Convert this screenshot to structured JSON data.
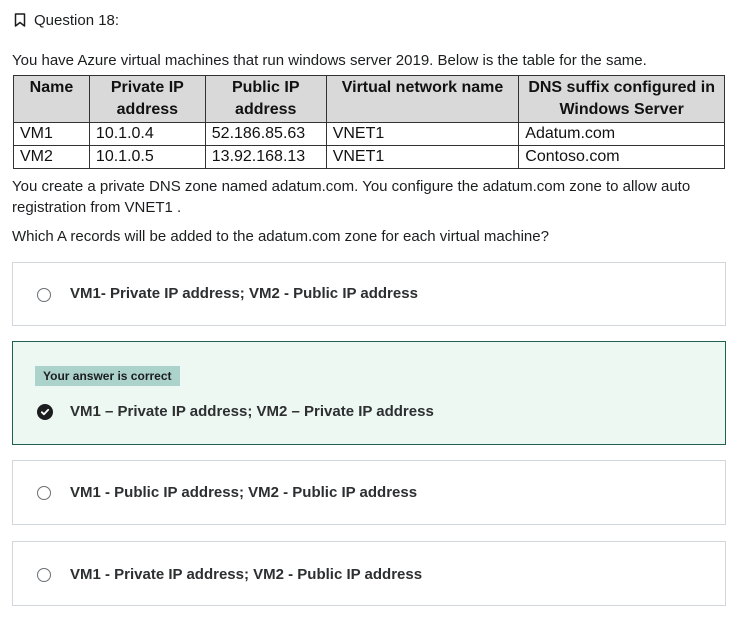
{
  "question": {
    "title": "Question 18:",
    "intro": "You have Azure virtual machines that run windows server 2019. Below is the table for the same.",
    "table": {
      "headers": [
        "Name",
        "Private IP address",
        "Public IP address",
        "Virtual network name",
        "DNS suffix configured in Windows Server"
      ],
      "rows": [
        [
          "VM1",
          "10.1.0.4",
          "52.186.85.63",
          "VNET1",
          "Adatum.com"
        ],
        [
          "VM2",
          "10.1.0.5",
          "13.92.168.13",
          "VNET1",
          "Contoso.com"
        ]
      ]
    },
    "paragraph1": "You create a private DNS zone named adatum.com. You configure the adatum.com zone to allow auto registration from VNET1 .",
    "paragraph2": "Which A records will be added to the adatum.com zone for each virtual machine?"
  },
  "options": [
    {
      "label": "VM1- Private IP address; VM2 - Public IP address"
    },
    {
      "label": "VM1 – Private IP address; VM2 – Private IP address",
      "badge": "Your answer is correct"
    },
    {
      "label": "VM1 - Public IP address; VM2 - Public IP address"
    },
    {
      "label": "VM1 - Private IP address; VM2 - Public IP address"
    }
  ]
}
